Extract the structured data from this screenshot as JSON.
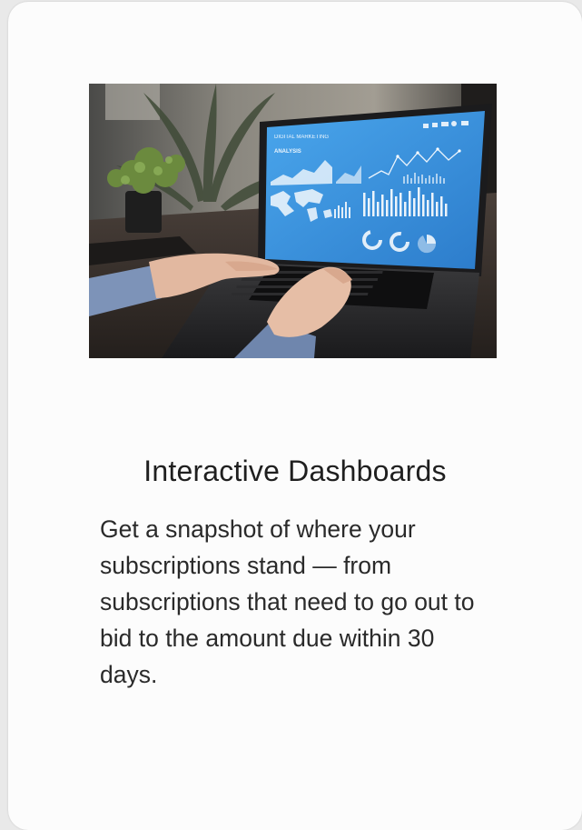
{
  "card": {
    "title": "Interactive Dashboards",
    "description": "Get a snapshot of where your subscriptions stand — from subscriptions that need to go out to bid to the amount due within 30 days."
  },
  "photo": {
    "screen_title": "DIGITAL MARKETING",
    "screen_section": "ANALYSIS",
    "colors": {
      "screen": "#3d8fd8",
      "wall": "#6f6b64",
      "desk": "#2f2a27"
    }
  }
}
